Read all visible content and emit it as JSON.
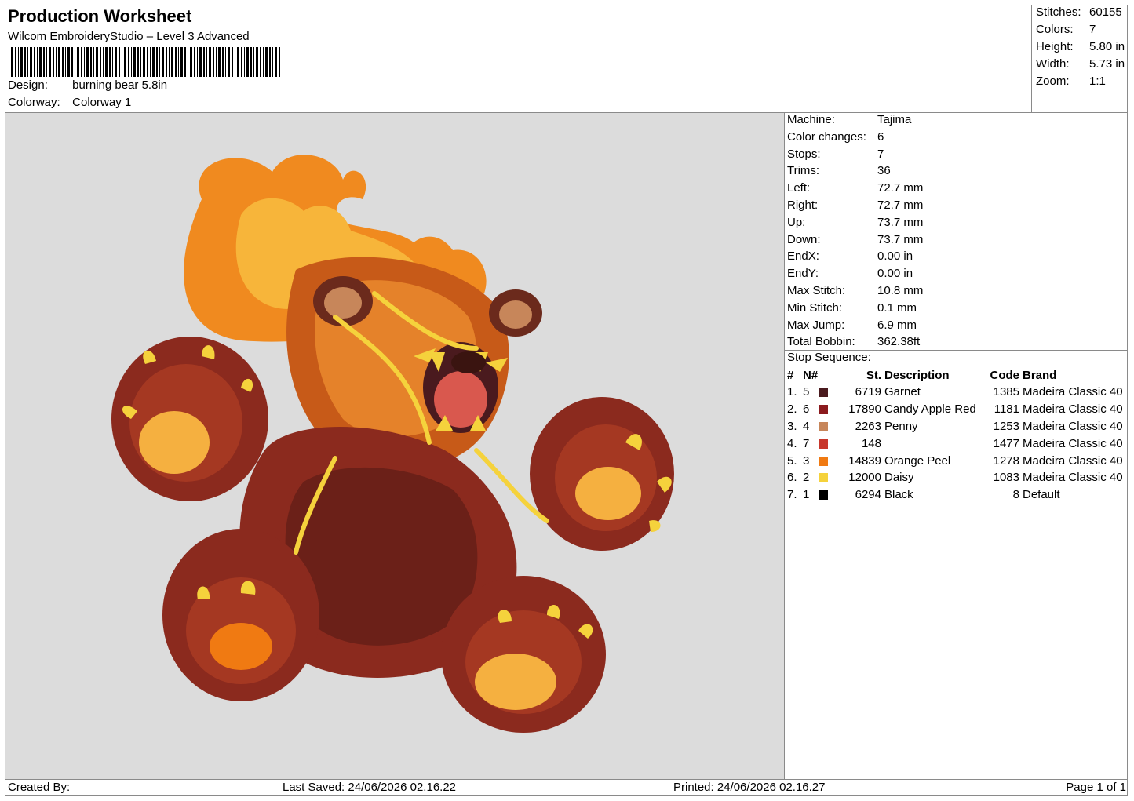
{
  "header": {
    "title": "Production Worksheet",
    "software": "Wilcom EmbroideryStudio – Level 3 Advanced",
    "design_label": "Design:",
    "design_value": "burning bear 5.8in",
    "colorway_label": "Colorway:",
    "colorway_value": "Colorway 1"
  },
  "summary": {
    "stitches_label": "Stitches:",
    "stitches": "60155",
    "colors_label": "Colors:",
    "colors": "7",
    "height_label": "Height:",
    "height": "5.80 in",
    "width_label": "Width:",
    "width": "5.73 in",
    "zoom_label": "Zoom:",
    "zoom": "1:1"
  },
  "machine_info": [
    {
      "label": "Machine:",
      "value": "Tajima"
    },
    {
      "label": "Color changes:",
      "value": "6"
    },
    {
      "label": "Stops:",
      "value": "7"
    },
    {
      "label": "Trims:",
      "value": "36"
    },
    {
      "label": "Left:",
      "value": "72.7 mm"
    },
    {
      "label": "Right:",
      "value": "72.7 mm"
    },
    {
      "label": "Up:",
      "value": "73.7 mm"
    },
    {
      "label": "Down:",
      "value": "73.7 mm"
    },
    {
      "label": "EndX:",
      "value": "0.00 in"
    },
    {
      "label": "EndY:",
      "value": "0.00 in"
    },
    {
      "label": "Max Stitch:",
      "value": "10.8 mm"
    },
    {
      "label": "Min Stitch:",
      "value": "0.1 mm"
    },
    {
      "label": "Max Jump:",
      "value": "6.9 mm"
    },
    {
      "label": "Total Bobbin:",
      "value": "362.38ft"
    }
  ],
  "stop_sequence": {
    "title": "Stop Sequence:",
    "headers": {
      "num": "#",
      "needle": "N#",
      "stitches": "St.",
      "description": "Description",
      "code": "Code",
      "brand": "Brand"
    },
    "rows": [
      {
        "num": "1.",
        "needle": "5",
        "color": "#4a1a1e",
        "stitches": "6719",
        "description": "Garnet",
        "code": "1385",
        "brand": "Madeira Classic 40"
      },
      {
        "num": "2.",
        "needle": "6",
        "color": "#8b1a1e",
        "stitches": "17890",
        "description": "Candy Apple Red",
        "code": "1181",
        "brand": "Madeira Classic 40"
      },
      {
        "num": "3.",
        "needle": "4",
        "color": "#c7865a",
        "stitches": "2263",
        "description": "Penny",
        "code": "1253",
        "brand": "Madeira Classic 40"
      },
      {
        "num": "4.",
        "needle": "7",
        "color": "#c8372c",
        "stitches": "148",
        "description": "",
        "code": "1477",
        "brand": "Madeira Classic 40"
      },
      {
        "num": "5.",
        "needle": "3",
        "color": "#f07a12",
        "stitches": "14839",
        "description": "Orange Peel",
        "code": "1278",
        "brand": "Madeira Classic 40"
      },
      {
        "num": "6.",
        "needle": "2",
        "color": "#f5d23c",
        "stitches": "12000",
        "description": "Daisy",
        "code": "1083",
        "brand": "Madeira Classic 40"
      },
      {
        "num": "7.",
        "needle": "1",
        "color": "#000000",
        "stitches": "6294",
        "description": "Black",
        "code": "8",
        "brand": "Default"
      }
    ]
  },
  "footer": {
    "created_by": "Created By:",
    "last_saved": "Last Saved: 24/06/2026 02.16.22",
    "printed": "Printed: 24/06/2026 02.16.27",
    "page": "Page 1 of 1"
  }
}
